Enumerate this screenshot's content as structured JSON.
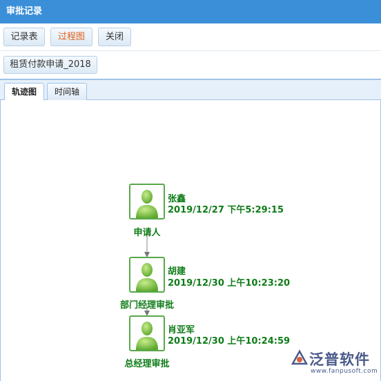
{
  "window": {
    "title": "审批记录"
  },
  "toolbar": {
    "record_table": "记录表",
    "process_chart": "过程图",
    "close": "关闭"
  },
  "document": {
    "name": "租赁付款申请_2018"
  },
  "tabs": [
    {
      "label": "轨迹图"
    },
    {
      "label": "时间轴"
    }
  ],
  "flow": {
    "steps": [
      {
        "name": "张鑫",
        "time": "2019/12/27 下午5:29:15",
        "role": "申请人"
      },
      {
        "name": "胡建",
        "time": "2019/12/30 上午10:23:20",
        "role": "部门经理审批"
      },
      {
        "name": "肖亚军",
        "time": "2019/12/30 上午10:24:59",
        "role": "总经理审批"
      }
    ]
  },
  "colors": {
    "accent": "#3b8fd9",
    "flow_text": "#0e7c17",
    "active_button": "#e2621b",
    "node_border": "#58a84a"
  },
  "watermark": {
    "text": "泛普软件",
    "url": "www.fanpusoft.com"
  }
}
